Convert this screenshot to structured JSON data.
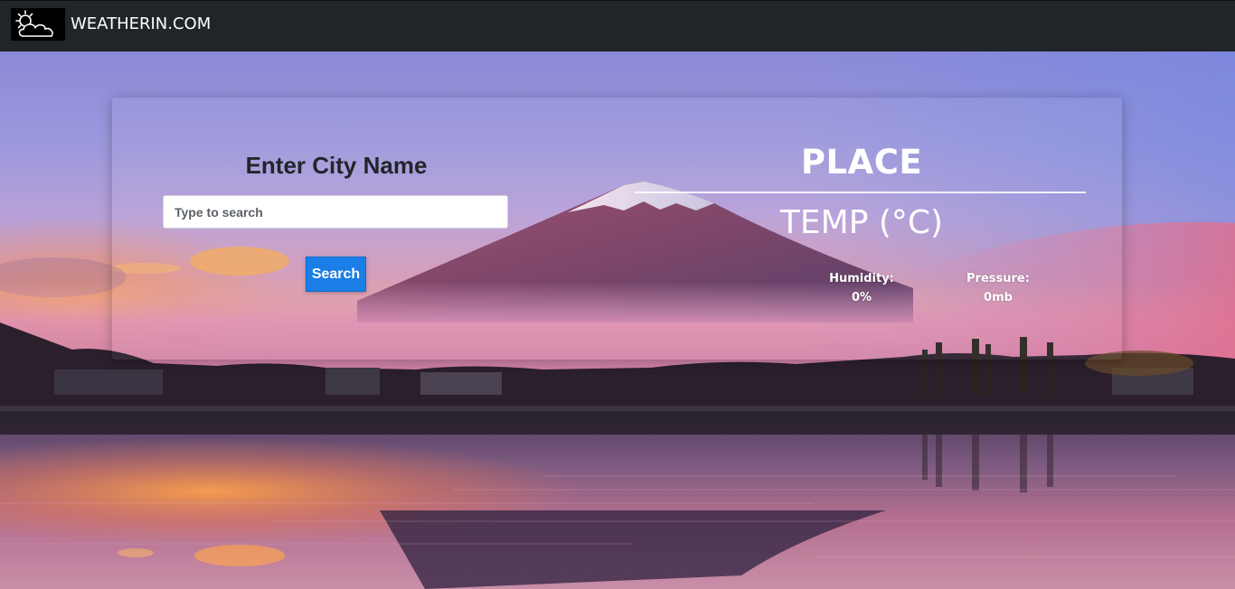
{
  "navbar": {
    "brand_text": "WEATHERIN.COM",
    "logo_icon": "sun-behind-cloud-icon"
  },
  "search": {
    "heading": "Enter City Name",
    "placeholder": "Type to search",
    "value": "",
    "button_label": "Search"
  },
  "weather": {
    "place": "PLACE",
    "temp": "TEMP (°C)",
    "humidity_label": "Humidity:",
    "humidity_value": "0%",
    "pressure_label": "Pressure:",
    "pressure_value": "0mb"
  },
  "colors": {
    "navbar_bg": "#212428",
    "button_accent": "#1a7ee6",
    "heading_text": "#22252a",
    "weather_text": "#ffffff"
  }
}
